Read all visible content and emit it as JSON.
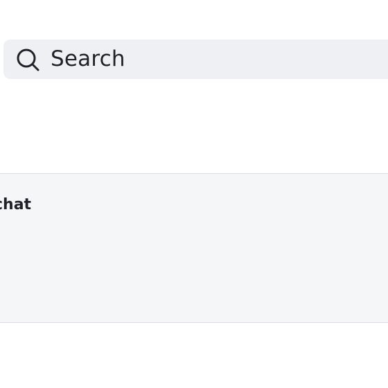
{
  "search": {
    "placeholder": "Search"
  },
  "panel": {
    "title": "chat"
  }
}
